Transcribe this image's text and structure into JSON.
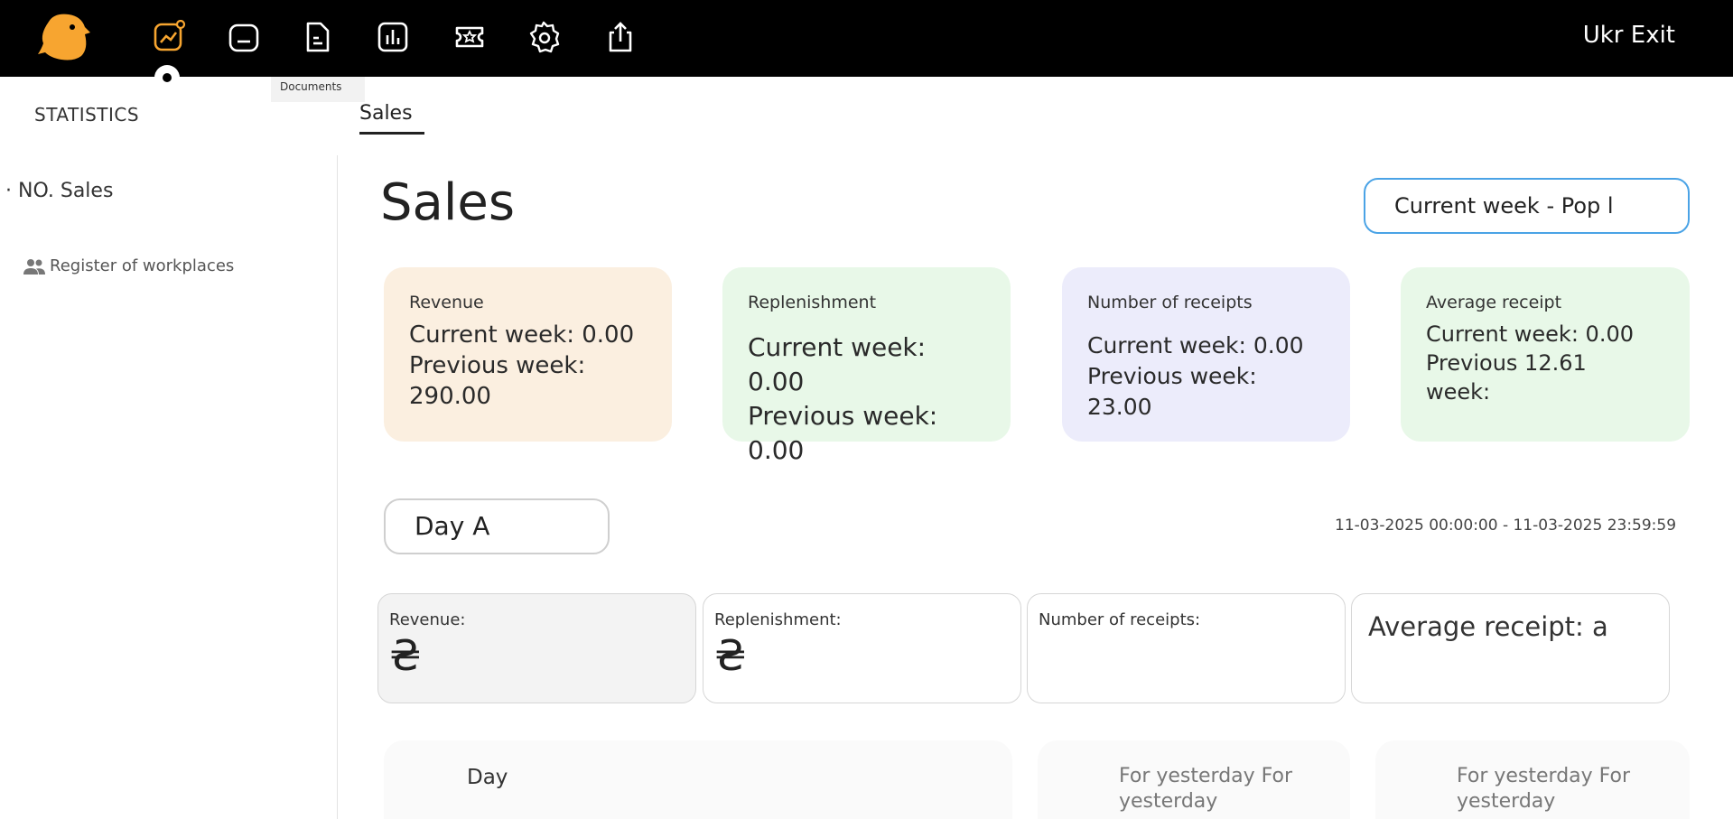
{
  "header": {
    "nav": [
      {
        "name": "statistics-icon"
      },
      {
        "name": "folder-icon"
      },
      {
        "name": "document-icon"
      },
      {
        "name": "bar-chart-icon"
      },
      {
        "name": "ticket-icon"
      },
      {
        "name": "gear-icon"
      },
      {
        "name": "upload-icon"
      }
    ],
    "lang": "Ukr",
    "exit": "Exit",
    "tooltip": "Documents"
  },
  "subheader": {
    "section": "STATISTICS",
    "tab": "Sales"
  },
  "sidebar": {
    "items": [
      {
        "label": "· NO. Sales"
      },
      {
        "label": "Register of workplaces"
      }
    ]
  },
  "main": {
    "title": "Sales",
    "period": "Current week - Pop l",
    "cards": {
      "revenue": {
        "title": "Revenue",
        "lines": [
          "Current week: 0.00",
          "Previous week:",
          "290.00"
        ]
      },
      "replenishment": {
        "title": "Replenishment",
        "lines": [
          "Current week: 0.00",
          "Previous week: 0.00"
        ]
      },
      "receipts": {
        "title": "Number of receipts",
        "lines": [
          "Current week: 0.00",
          "Previous week: 23.00"
        ]
      },
      "average": {
        "title": "Average receipt",
        "lines": [
          "Current week: 0.00",
          "Previous 12.61",
          "week:"
        ]
      }
    },
    "day_select": "Day A",
    "date_range": "11-03-2025 00:00:00 - 11-03-2025 23:59:59",
    "metrics": {
      "revenue": {
        "label": "Revenue:",
        "value": "₴"
      },
      "replenishment": {
        "label": "Replenishment:",
        "value": "₴"
      },
      "receipts": {
        "label": "Number of receipts:",
        "value": ""
      },
      "average": {
        "label": "Average receipt: a",
        "value": ""
      }
    },
    "bottom": {
      "day": "Day",
      "yesterday1": "For yesterday For yesterday",
      "yesterday2": "For yesterday For yesterday"
    }
  },
  "colors": {
    "accent": "#f7a530",
    "revenue_card": "#fbefe0",
    "replenish_card": "#e8f8e8",
    "receipts_card": "#ececfb",
    "average_card": "#e8f8e8",
    "select_border": "#4aa3e6"
  }
}
